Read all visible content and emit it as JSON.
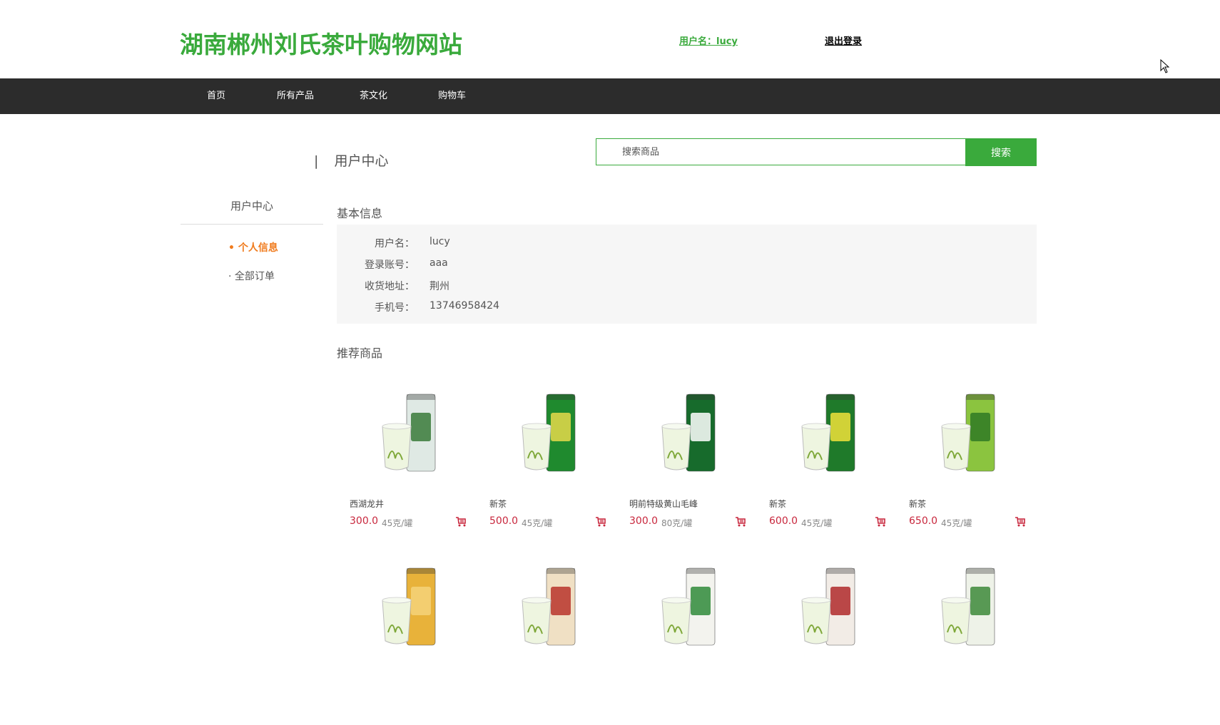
{
  "header": {
    "site_title": "湖南郴州刘氏茶叶购物网站",
    "user_label": "用户名：lucy",
    "logout_label": "退出登录"
  },
  "nav": {
    "items": [
      {
        "label": "首页"
      },
      {
        "label": "所有产品"
      },
      {
        "label": "茶文化"
      },
      {
        "label": "购物车"
      }
    ]
  },
  "breadcrumb": {
    "separator": "|",
    "title": "用户中心"
  },
  "search": {
    "placeholder": "搜索商品",
    "button_label": "搜索"
  },
  "sidebar": {
    "title": "用户中心",
    "items": [
      {
        "label": "• 个人信息",
        "active": true
      },
      {
        "label": "· 全部订单",
        "active": false
      }
    ]
  },
  "basic_info": {
    "title": "基本信息",
    "rows": [
      {
        "label": "用户名：",
        "value": "lucy"
      },
      {
        "label": "登录账号：",
        "value": "aaa"
      },
      {
        "label": "收货地址：",
        "value": "荆州"
      },
      {
        "label": "手机号：",
        "value": "13746958424"
      }
    ]
  },
  "recommended": {
    "title": "推荐商品",
    "products": [
      {
        "name": "西湖龙井",
        "price": "300.0",
        "spec": "45克/罐",
        "can_color": "#dfe9e4",
        "label_color": "#3a7a3a"
      },
      {
        "name": "新茶",
        "price": "500.0",
        "spec": "45克/罐",
        "can_color": "#1f8a2e",
        "label_color": "#e6d94a"
      },
      {
        "name": "明前特级黄山毛峰",
        "price": "300.0",
        "spec": "80克/罐",
        "can_color": "#176b2c",
        "label_color": "#ffffff"
      },
      {
        "name": "新茶",
        "price": "600.0",
        "spec": "45克/罐",
        "can_color": "#1f7a2a",
        "label_color": "#f1e23a"
      },
      {
        "name": "新茶",
        "price": "650.0",
        "spec": "45克/罐",
        "can_color": "#8bc43f",
        "label_color": "#2f7a25"
      },
      {
        "can_color": "#e8b23a",
        "label_color": "#f5d27a"
      },
      {
        "can_color": "#f0e0c4",
        "label_color": "#b8342c"
      },
      {
        "can_color": "#f3f3ee",
        "label_color": "#2f8a3a"
      },
      {
        "can_color": "#f2ece6",
        "label_color": "#b02a2a"
      },
      {
        "can_color": "#eef2e8",
        "label_color": "#3d8a3a"
      }
    ]
  }
}
